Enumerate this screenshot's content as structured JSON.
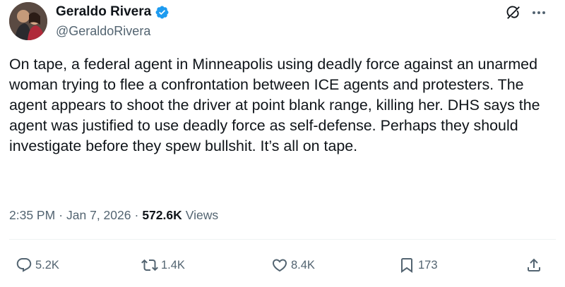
{
  "author": {
    "display_name": "Geraldo Rivera",
    "handle": "@GeraldoRivera",
    "verified": true,
    "verified_color": "#1d9bf0"
  },
  "tweet": {
    "text": "On tape, a federal agent in Minneapolis using deadly force against an unarmed woman trying to flee a confrontation between ICE agents and protesters. The agent appears to shoot the driver at point blank range, killing her. DHS says the agent was justified to use deadly force as self-defense. Perhaps they should investigate before they spew bullshit. It’s all on tape."
  },
  "meta": {
    "time": "2:35 PM",
    "separator": "·",
    "date": "Jan 7, 2026",
    "views_count": "572.6K",
    "views_label": "Views"
  },
  "actions": {
    "replies": "5.2K",
    "reposts": "1.4K",
    "likes": "8.4K",
    "bookmarks": "173"
  },
  "icons": [
    "grok-icon",
    "more-icon",
    "reply-icon",
    "repost-icon",
    "like-icon",
    "bookmark-icon",
    "share-icon",
    "verified-badge-icon"
  ]
}
